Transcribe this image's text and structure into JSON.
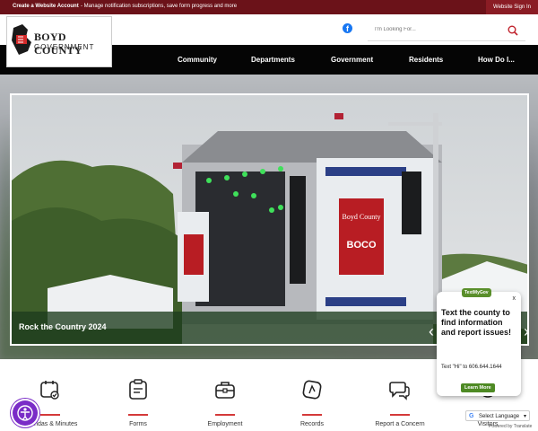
{
  "topbar": {
    "create": "Create a Website Account",
    "manage": " - Manage notification subscriptions, save form progress and more",
    "signin": "Website Sign In"
  },
  "header": {
    "search_placeholder": "I'm Looking For..."
  },
  "logo": {
    "title": "BOYD COUNTY",
    "subtitle": "GOVERNMENT"
  },
  "nav": {
    "items": [
      "Community",
      "Departments",
      "Government",
      "Residents",
      "How Do I..."
    ]
  },
  "hero": {
    "caption": "Rock the Country 2024",
    "banner_title": "Boyd County",
    "banner_tag": "BOCO"
  },
  "quick_links": [
    {
      "label": "Agendas & Minutes",
      "icon": "calendar-check-icon"
    },
    {
      "label": "Forms",
      "icon": "clipboard-icon"
    },
    {
      "label": "Employment",
      "icon": "briefcase-icon"
    },
    {
      "label": "Records",
      "icon": "records-icon"
    },
    {
      "label": "Report a Concern",
      "icon": "chat-bubbles-icon"
    },
    {
      "label": "Visitors",
      "icon": "visitors-icon"
    }
  ],
  "textmygov": {
    "badge": "TextMyGov",
    "close": "x",
    "headline": "Text the county to find information and report issues!",
    "body": "Text \"Hi\" to 606.644.1644",
    "learn": "Learn More"
  },
  "translate": {
    "label": "Select Language",
    "powered": "Powered by Translate"
  },
  "colors": {
    "topbar": "#6b1219",
    "nav": "#050505",
    "accent": "#d43a3a",
    "textmygov_green": "#4e8a24"
  }
}
